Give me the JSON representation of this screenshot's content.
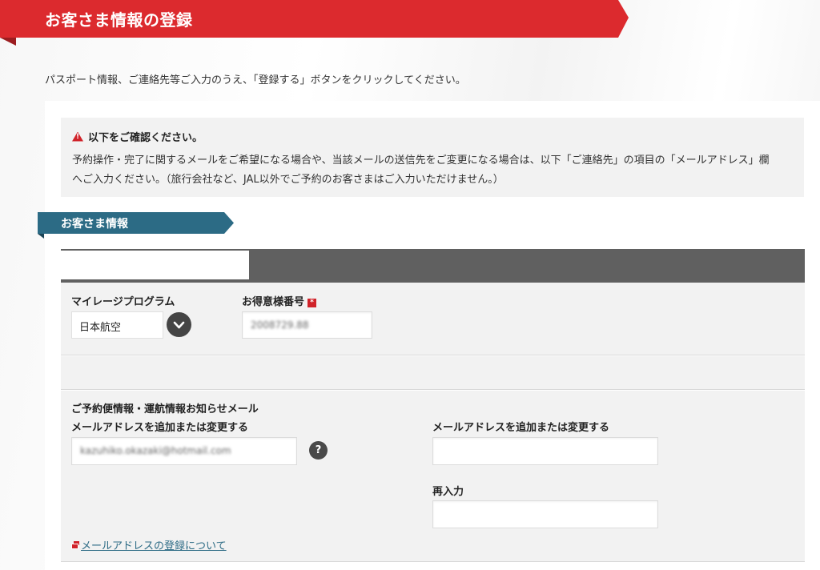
{
  "header": {
    "title": "お客さま情報の登録"
  },
  "intro_text": "パスポート情報、ご連絡先等ご入力のうえ、「登録する」ボタンをクリックしてください。",
  "notice": {
    "heading": "以下をご確認ください。",
    "body": "予約操作・完了に関するメールをご希望になる場合や、当該メールの送信先をご変更になる場合は、以下「ご連絡先」の項目の「メールアドレス」欄へご入力ください。（旅行会社など、JAL以外でご予約のお客さまはご入力いただけません。）"
  },
  "section": {
    "title": "お客さま情報"
  },
  "mileage": {
    "program_label": "マイレージプログラム",
    "program_value": "日本航空",
    "member_number_label": "お得意様番号",
    "required_mark": "*",
    "member_number_value": "2008729.88"
  },
  "email": {
    "group_label": "ご予約便情報・運航情報お知らせメール",
    "left_label": "メールアドレスを追加または変更する",
    "left_value": "kazuhiko.okazaki@hotmail.com",
    "help_label": "?",
    "right_label": "メールアドレスを追加または変更する",
    "right_value": "",
    "reenter_label": "再入力",
    "reenter_value": "",
    "link_text": "メールアドレスの登録について"
  },
  "colors": {
    "brand_red": "#dc2a2e",
    "ribbon_teal": "#2c6b85",
    "tab_bar_gray": "#606060"
  }
}
